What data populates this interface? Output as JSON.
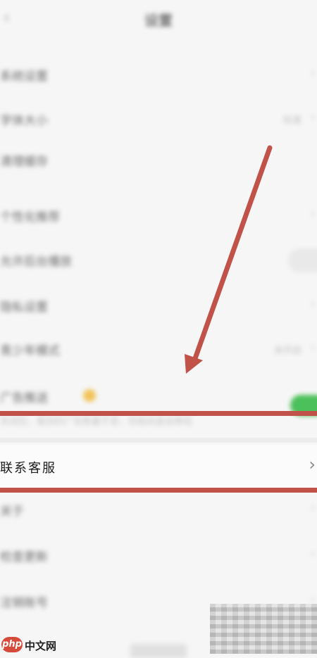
{
  "header": {
    "title": "设置",
    "back_icon": "chevron-left-icon"
  },
  "settings": [
    {
      "label": "系统设置"
    },
    {
      "label": "字体大小",
      "value": "标准"
    },
    {
      "label": "清理缓存",
      "sub": "",
      "value": ""
    },
    {
      "label": "个性化推荐"
    },
    {
      "label": "允许后台播放"
    },
    {
      "label": "隐私设置"
    },
    {
      "label": "青少年模式",
      "value": "未开启"
    },
    {
      "label": "广告推送",
      "sub": "关闭后，看到的广告数量不变，但相关度会降低"
    }
  ],
  "highlight_row": {
    "label": "联系客服"
  },
  "settings_after": [
    {
      "label": "关于"
    },
    {
      "label": "检查更新"
    },
    {
      "label": "注销账号"
    }
  ],
  "annotation": {
    "color": "#c0524a"
  },
  "watermark": {
    "badge": "php",
    "text": "中文网"
  }
}
